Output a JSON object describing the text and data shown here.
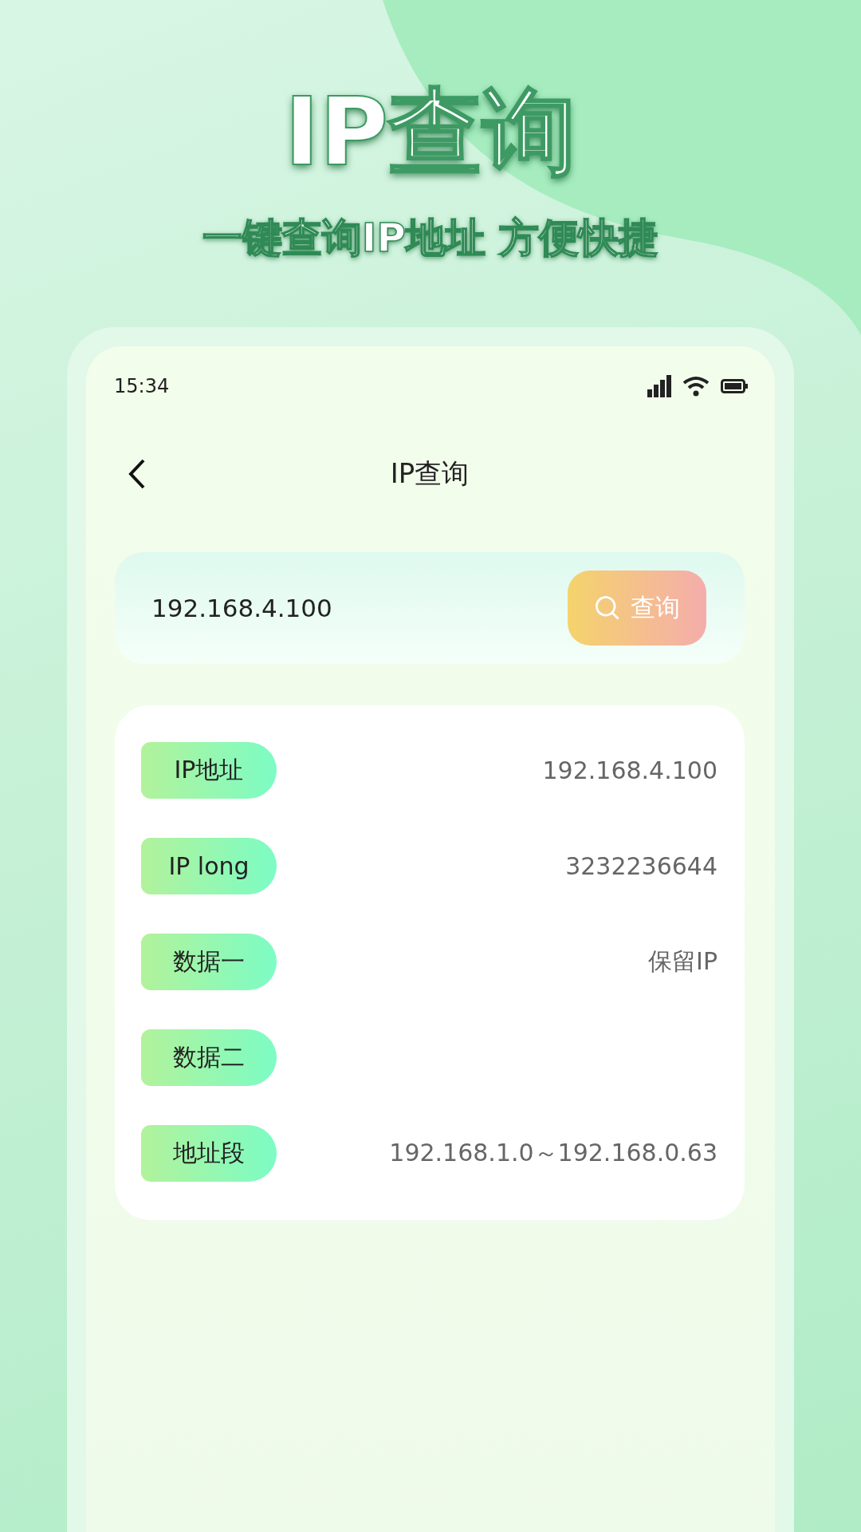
{
  "headline": "IP查询",
  "subtitle": "一键查询IP地址 方便快捷",
  "status_bar": {
    "time": "15:34"
  },
  "nav": {
    "title": "IP查询"
  },
  "search": {
    "value": "192.168.4.100",
    "button": "查询"
  },
  "results": [
    {
      "label": "IP地址",
      "value": "192.168.4.100"
    },
    {
      "label": "IP long",
      "value": "3232236644"
    },
    {
      "label": "数据一",
      "value": "保留IP"
    },
    {
      "label": "数据二"
    },
    {
      "label": "地址段",
      "value": "192.168.1.0～192.168.0.63"
    }
  ]
}
